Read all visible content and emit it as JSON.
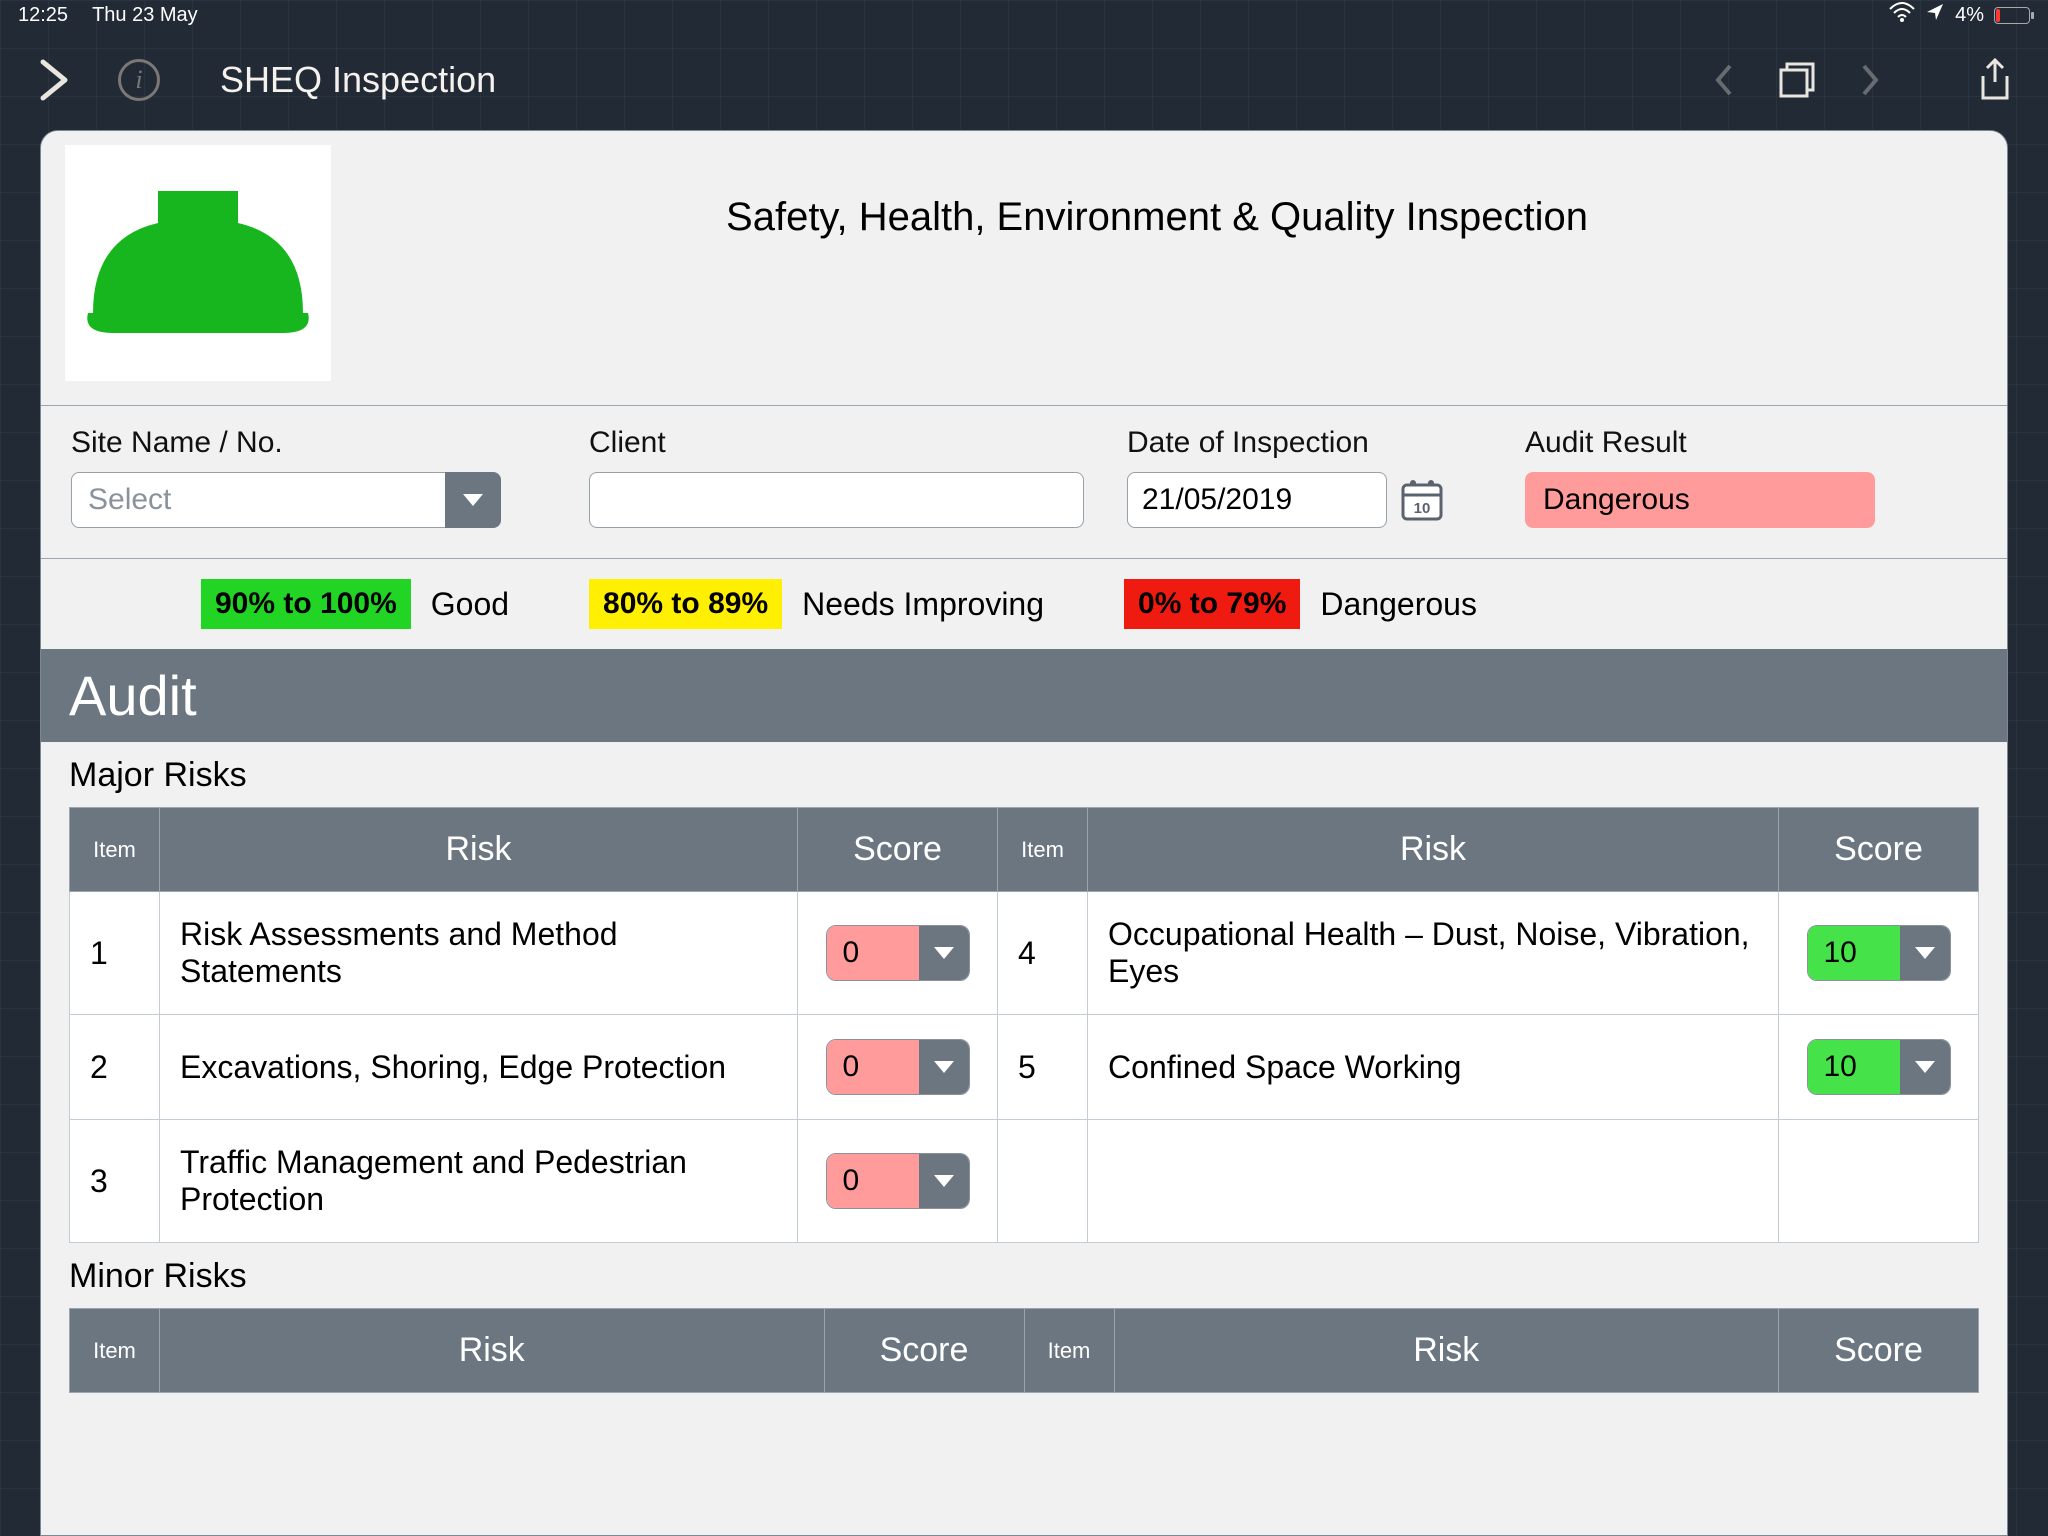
{
  "status": {
    "time": "12:25",
    "date": "Thu 23 May",
    "battery_pct": "4%"
  },
  "nav": {
    "title": "SHEQ Inspection"
  },
  "header": {
    "title": "Safety, Health, Environment & Quality Inspection"
  },
  "form": {
    "site_label": "Site Name / No.",
    "site_placeholder": "Select",
    "client_label": "Client",
    "client_value": "",
    "date_label": "Date of Inspection",
    "date_value": "21/05/2019",
    "result_label": "Audit Result",
    "result_value": "Dangerous"
  },
  "legend": {
    "good_range": "90% to 100%",
    "good_label": "Good",
    "mid_range": "80% to 89%",
    "mid_label": "Needs Improving",
    "bad_range": "0% to 79%",
    "bad_label": "Dangerous"
  },
  "audit": {
    "section_title": "Audit",
    "major_label": "Major Risks",
    "minor_label": "Minor Risks",
    "th_item": "Item",
    "th_risk": "Risk",
    "th_score": "Score",
    "major": [
      {
        "item": "1",
        "risk": "Risk Assessments and Method Statements",
        "score": "0",
        "color": "red"
      },
      {
        "item": "2",
        "risk": "Excavations, Shoring, Edge Protection",
        "score": "0",
        "color": "red"
      },
      {
        "item": "3",
        "risk": "Traffic Management and Pedestrian Protection",
        "score": "0",
        "color": "red"
      },
      {
        "item": "4",
        "risk": "Occupational Health – Dust, Noise, Vibration, Eyes",
        "score": "10",
        "color": "green"
      },
      {
        "item": "5",
        "risk": "Confined Space Working",
        "score": "10",
        "color": "green"
      }
    ]
  }
}
